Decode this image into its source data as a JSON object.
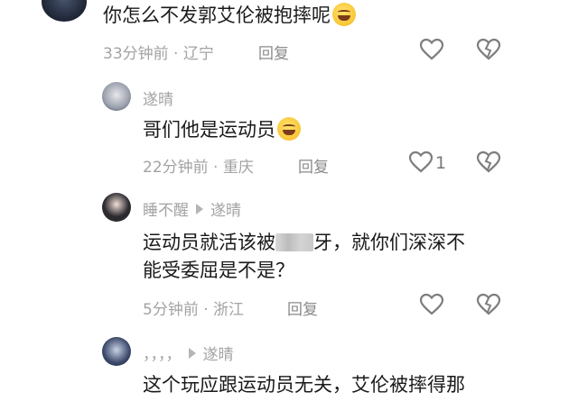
{
  "comments": [
    {
      "text": "你怎么不发郭艾伦被抱摔呢",
      "time": "33分钟前",
      "location": "辽宁",
      "reply_label": "回复",
      "avatar_icon": "dark-portrait-avatar"
    },
    {
      "author": "遂晴",
      "text": "哥们他是运动员",
      "time": "22分钟前",
      "location": "重庆",
      "reply_label": "回复",
      "like_count": "1",
      "avatar_icon": "white-figure-avatar"
    },
    {
      "author": "睡不醒",
      "reply_to": "遂晴",
      "text_line1_a": "运动员就活该被",
      "text_line1_b": "牙，就你们深深不",
      "text_line2": "能受委屈是不是？",
      "time": "5分钟前",
      "location": "浙江",
      "reply_label": "回复",
      "avatar_icon": "anime-girl-avatar"
    },
    {
      "author": "，，，，",
      "reply_to": "遂晴",
      "text": "这个玩应跟运动员无关，艾伦被摔得那",
      "avatar_icon": "character-avatar"
    }
  ],
  "separator": "·",
  "colors": {
    "text": "#1a1a1a",
    "meta": "#a3a3a3",
    "icon": "#7d7d7d"
  }
}
